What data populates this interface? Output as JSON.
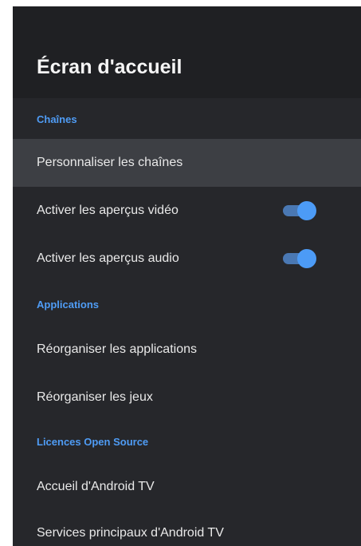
{
  "header": {
    "title": "Écran d'accueil"
  },
  "sections": {
    "channels": {
      "title": "Chaînes",
      "customize": "Personnaliser les chaînes",
      "video_previews": {
        "label": "Activer les aperçus vidéo",
        "enabled": true
      },
      "audio_previews": {
        "label": "Activer les aperçus audio",
        "enabled": true
      }
    },
    "apps": {
      "title": "Applications",
      "reorder_apps": "Réorganiser les applications",
      "reorder_games": "Réorganiser les jeux"
    },
    "licenses": {
      "title": "Licences Open Source",
      "android_tv_home": "Accueil d'Android TV",
      "android_tv_core_services": "Services principaux d'Android TV"
    }
  },
  "colors": {
    "accent": "#4c9bf6",
    "panel_bg": "#26272b",
    "header_bg": "#1f2023",
    "focused_bg": "#3d3f44"
  }
}
